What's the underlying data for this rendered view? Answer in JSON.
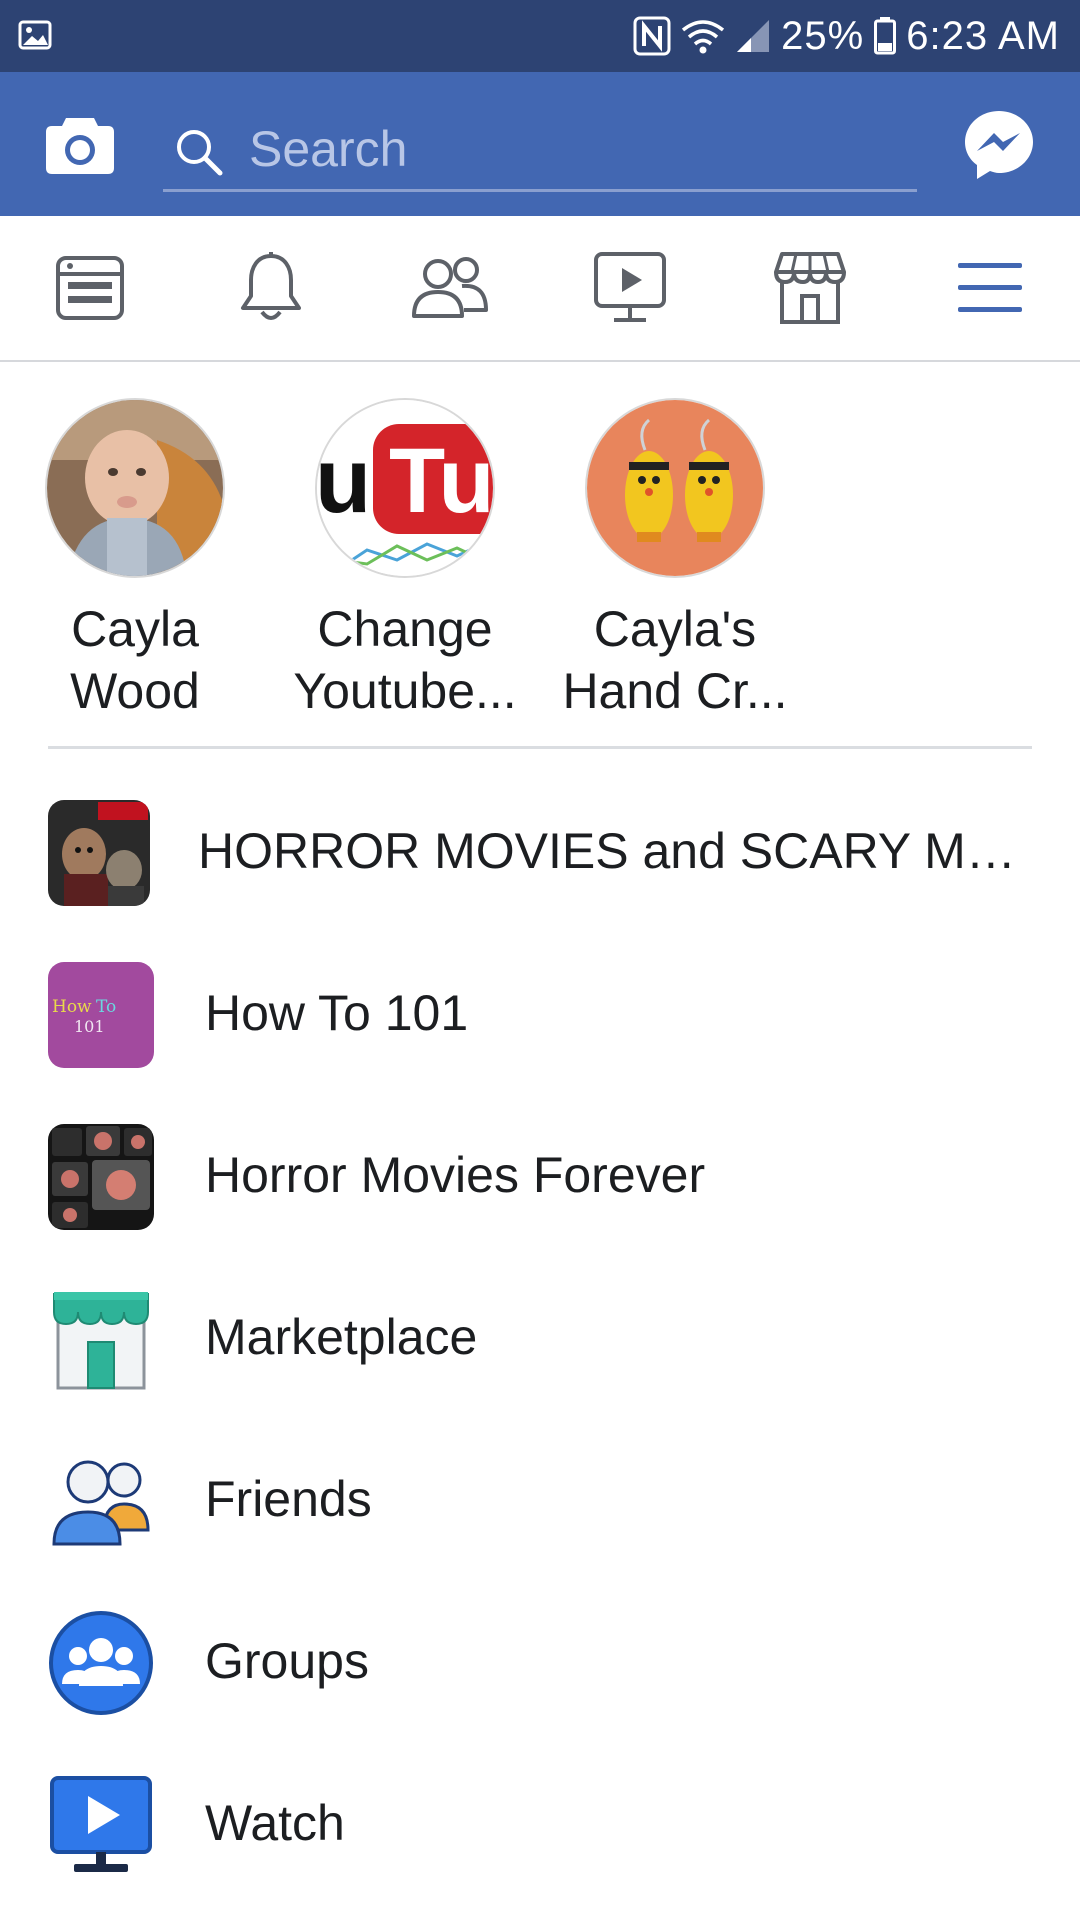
{
  "status_bar": {
    "battery": "25%",
    "time": "6:23 AM",
    "icons": [
      "gallery-icon",
      "nfc-icon",
      "wifi-icon",
      "signal-icon",
      "battery-icon"
    ]
  },
  "header": {
    "search_placeholder": "Search",
    "icons": [
      "camera-icon",
      "search-icon",
      "messenger-icon"
    ],
    "accent_color": "#4267b2",
    "status_color": "#2d4373"
  },
  "nav_tabs": [
    {
      "name": "news-feed",
      "icon": "news-feed-icon",
      "active": false
    },
    {
      "name": "notifications",
      "icon": "bell-icon",
      "active": false
    },
    {
      "name": "friend-requests",
      "icon": "friends-icon",
      "active": false
    },
    {
      "name": "watch",
      "icon": "video-icon",
      "active": false
    },
    {
      "name": "marketplace",
      "icon": "store-icon",
      "active": false
    },
    {
      "name": "menu",
      "icon": "hamburger-icon",
      "active": true
    }
  ],
  "shortcuts": [
    {
      "line1": "Cayla",
      "line2": "Wood"
    },
    {
      "line1": "Change",
      "line2": "Youtube..."
    },
    {
      "line1": "Cayla's",
      "line2": "Hand Cr..."
    }
  ],
  "menu": [
    {
      "label": "HORROR MOVIES and SCARY MO...",
      "icon": "horror-page-icon"
    },
    {
      "label": "How To 101",
      "icon": "how-to-page-icon",
      "icon_text": "How To 101"
    },
    {
      "label": "Horror Movies Forever",
      "icon": "tv-wall-page-icon"
    },
    {
      "label": "Marketplace",
      "icon": "marketplace-icon"
    },
    {
      "label": "Friends",
      "icon": "friends-icon"
    },
    {
      "label": "Groups",
      "icon": "groups-icon"
    },
    {
      "label": "Watch",
      "icon": "watch-icon"
    }
  ]
}
